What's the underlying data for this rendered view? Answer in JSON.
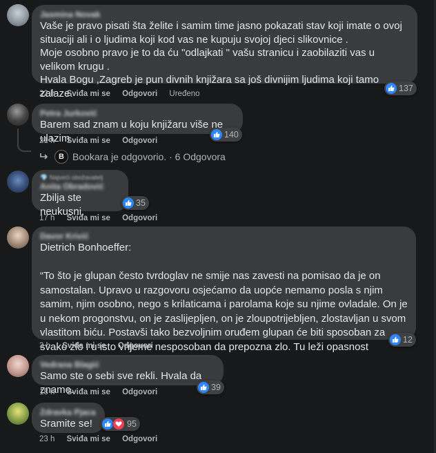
{
  "comments": [
    {
      "author": "Jasmina Novak",
      "text": "Vaše je pravo pisati šta želite i samim time jasno pokazati stav koji imate o ovoj situaciji ali i o ljudima koji kod vas ne kupuju svojoj djeci slikovnice .\nMoje osobno pravo je to da ću \"odlajkati \" vašu stranicu i zaobilaziti vas u velikom krugu .\nHvala Bogu ,Zagreb je pun divnih knjižara sa još divnijim ljudima koji tamo zalaze.",
      "time": "22 h",
      "like": "Sviđa mi se",
      "reply": "Odgovori",
      "edited": "Uređeno",
      "reactions": "137"
    },
    {
      "author": "Petra Jurković",
      "text": "Barem sad znam u koju knjižaru više ne ulazim",
      "time": "21 h",
      "like": "Sviđa mi se",
      "reply": "Odgovori",
      "reactions": "140",
      "replies_text": "Bookara je odgovorio. · 6 Odgovora",
      "page_initial": "B"
    },
    {
      "badge": "Najveći obožavatelj",
      "author": "Anita Obradović",
      "text": "Zbilja ste neukusni.",
      "time": "17 h",
      "like": "Sviđa mi se",
      "reply": "Odgovori",
      "reactions": "35"
    },
    {
      "author": "Davor Krivić",
      "text": "Dietrich Bonhoeffer:\n\n“To što je glupan često tvrdoglav ne smije nas zavesti na pomisao da je on samostalan. Upravo u razgovoru osjećamo da uopće nemamo posla s njim samim, njim osobno, nego s krilaticama i parolama koje su njime ovladale. On je u nekom progonstvu, on je zaslijepljen, on je zloupotrijebljen, zlostavljan u svom vlastitom biću. Postavši tako bezvoljnim oruđem glupan će biti sposoban za svako zlo i u isto vrijeme nesposoban da prepozna zlo. Tu leži opasnost đavolske upotrebe.”",
      "time": "3 h",
      "like": "Sviđa mi se",
      "reply": "Odgovori",
      "reactions": "12"
    },
    {
      "author": "Vedrana Blagić",
      "text": "Samo ste o sebi sve rekli. Hvala da znamo.",
      "time": "18 h",
      "like": "Sviđa mi se",
      "reply": "Odgovori",
      "reactions": "39"
    },
    {
      "author": "Zdravka Pjaca",
      "text": "Sramite se!",
      "time": "23 h",
      "like": "Sviđa mi se",
      "reply": "Odgovori",
      "reactions": "95"
    }
  ],
  "colors": {
    "background": "#18191a",
    "bubble": "#3a3b3c",
    "like_blue": "#2d88ff",
    "love_red": "#f33e58"
  }
}
